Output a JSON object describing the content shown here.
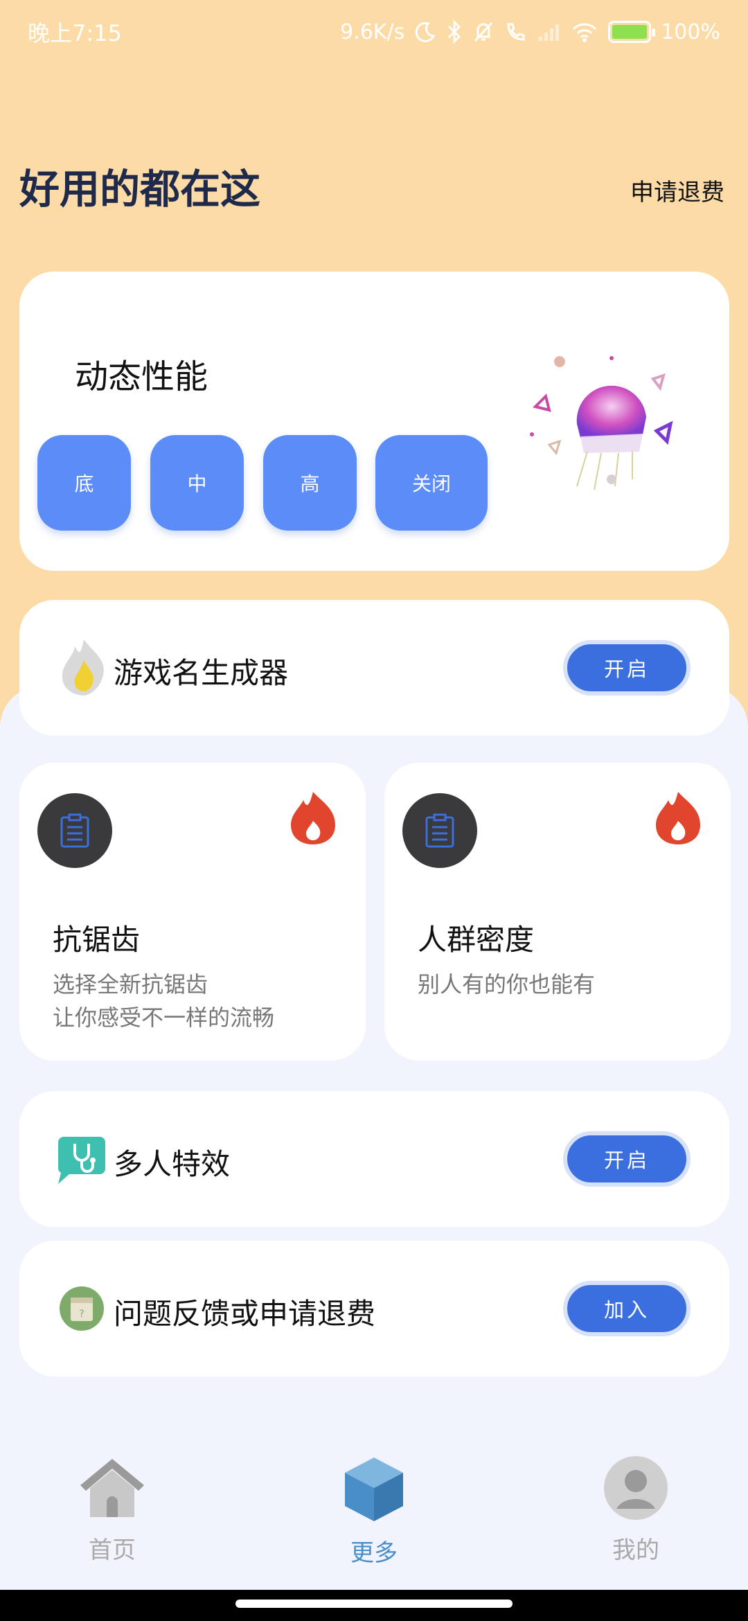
{
  "status_bar": {
    "time": "晚上7:15",
    "net_speed": "9.6K/s",
    "battery": "100%"
  },
  "header": {
    "title": "好用的都在这",
    "refund_link": "申请退费"
  },
  "performance": {
    "title": "动态性能",
    "options": [
      "底",
      "中",
      "高",
      "关闭"
    ]
  },
  "name_generator": {
    "label": "游戏名生成器",
    "button": "开启"
  },
  "anti_alias": {
    "title": "抗锯齿",
    "desc_line1": "选择全新抗锯齿",
    "desc_line2": "让你感受不一样的流畅"
  },
  "crowd_density": {
    "title": "人群密度",
    "desc_line1": "别人有的你也能有"
  },
  "multi_effect": {
    "label": "多人特效",
    "button": "开启"
  },
  "feedback": {
    "label": "问题反馈或申请退费",
    "button": "加入"
  },
  "tabs": [
    {
      "label": "首页",
      "icon": "home-icon"
    },
    {
      "label": "更多",
      "icon": "cube-icon"
    },
    {
      "label": "我的",
      "icon": "profile-icon"
    }
  ],
  "colors": {
    "header_bg": "#fcdba7",
    "accent_blue": "#3b6fe0",
    "option_blue": "#5b8cf7",
    "active_tab": "#4a8ec9"
  }
}
